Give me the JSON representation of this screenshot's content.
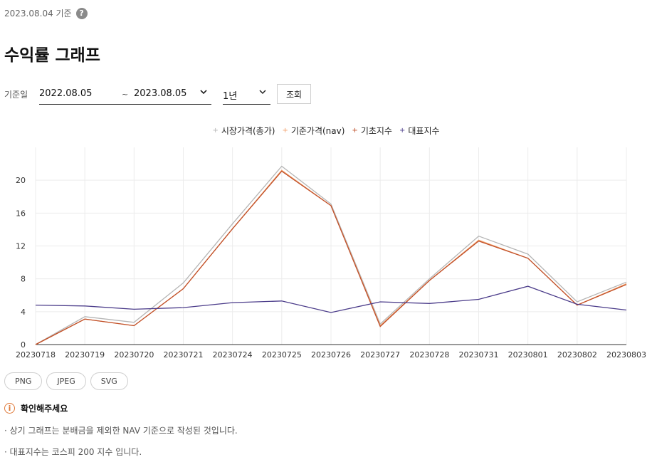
{
  "header": {
    "basis_date": "2023.08.04 기준",
    "help_symbol": "?"
  },
  "title": "수익률 그래프",
  "filter": {
    "label": "기준일",
    "start_date": "2022.08.05",
    "separator": "~",
    "end_date": "2023.08.05",
    "period": "1년",
    "search_label": "조회"
  },
  "chart_data": {
    "type": "line",
    "x": [
      "20230718",
      "20230719",
      "20230720",
      "20230721",
      "20230724",
      "20230725",
      "20230726",
      "20230727",
      "20230728",
      "20230731",
      "20230801",
      "20230802",
      "20230803"
    ],
    "ylim": [
      0,
      24
    ],
    "yticks": [
      0,
      4,
      8,
      12,
      16,
      20
    ],
    "grid": true,
    "legend_position": "top-center",
    "series": [
      {
        "name": "시장가격(총가)",
        "color": "#b5b5b5",
        "values": [
          0,
          3.4,
          2.7,
          7.5,
          14.7,
          21.7,
          17.1,
          2.5,
          8.0,
          13.2,
          11.0,
          5.2,
          7.6
        ]
      },
      {
        "name": "기준가격(nav)",
        "color": "#f2a06a",
        "values": [
          0,
          3.1,
          2.3,
          6.8,
          14.1,
          21.2,
          16.9,
          2.3,
          7.8,
          12.7,
          10.5,
          4.8,
          7.4
        ]
      },
      {
        "name": "기초지수",
        "color": "#c0502a",
        "values": [
          0,
          3.1,
          2.3,
          6.8,
          14.1,
          21.1,
          16.9,
          2.2,
          7.8,
          12.6,
          10.5,
          4.8,
          7.3
        ]
      },
      {
        "name": "대표지수",
        "color": "#4b3c8a",
        "values": [
          4.8,
          4.7,
          4.3,
          4.5,
          5.1,
          5.3,
          3.9,
          5.2,
          5.0,
          5.5,
          7.1,
          4.9,
          4.2
        ]
      }
    ]
  },
  "exports": [
    "PNG",
    "JPEG",
    "SVG"
  ],
  "notice": {
    "title": "확인해주세요",
    "items": [
      "상기 그래프는 분배금을 제외한 NAV 기준으로 작성된 것입니다.",
      "대표지수는 코스피 200 지수 입니다."
    ]
  }
}
